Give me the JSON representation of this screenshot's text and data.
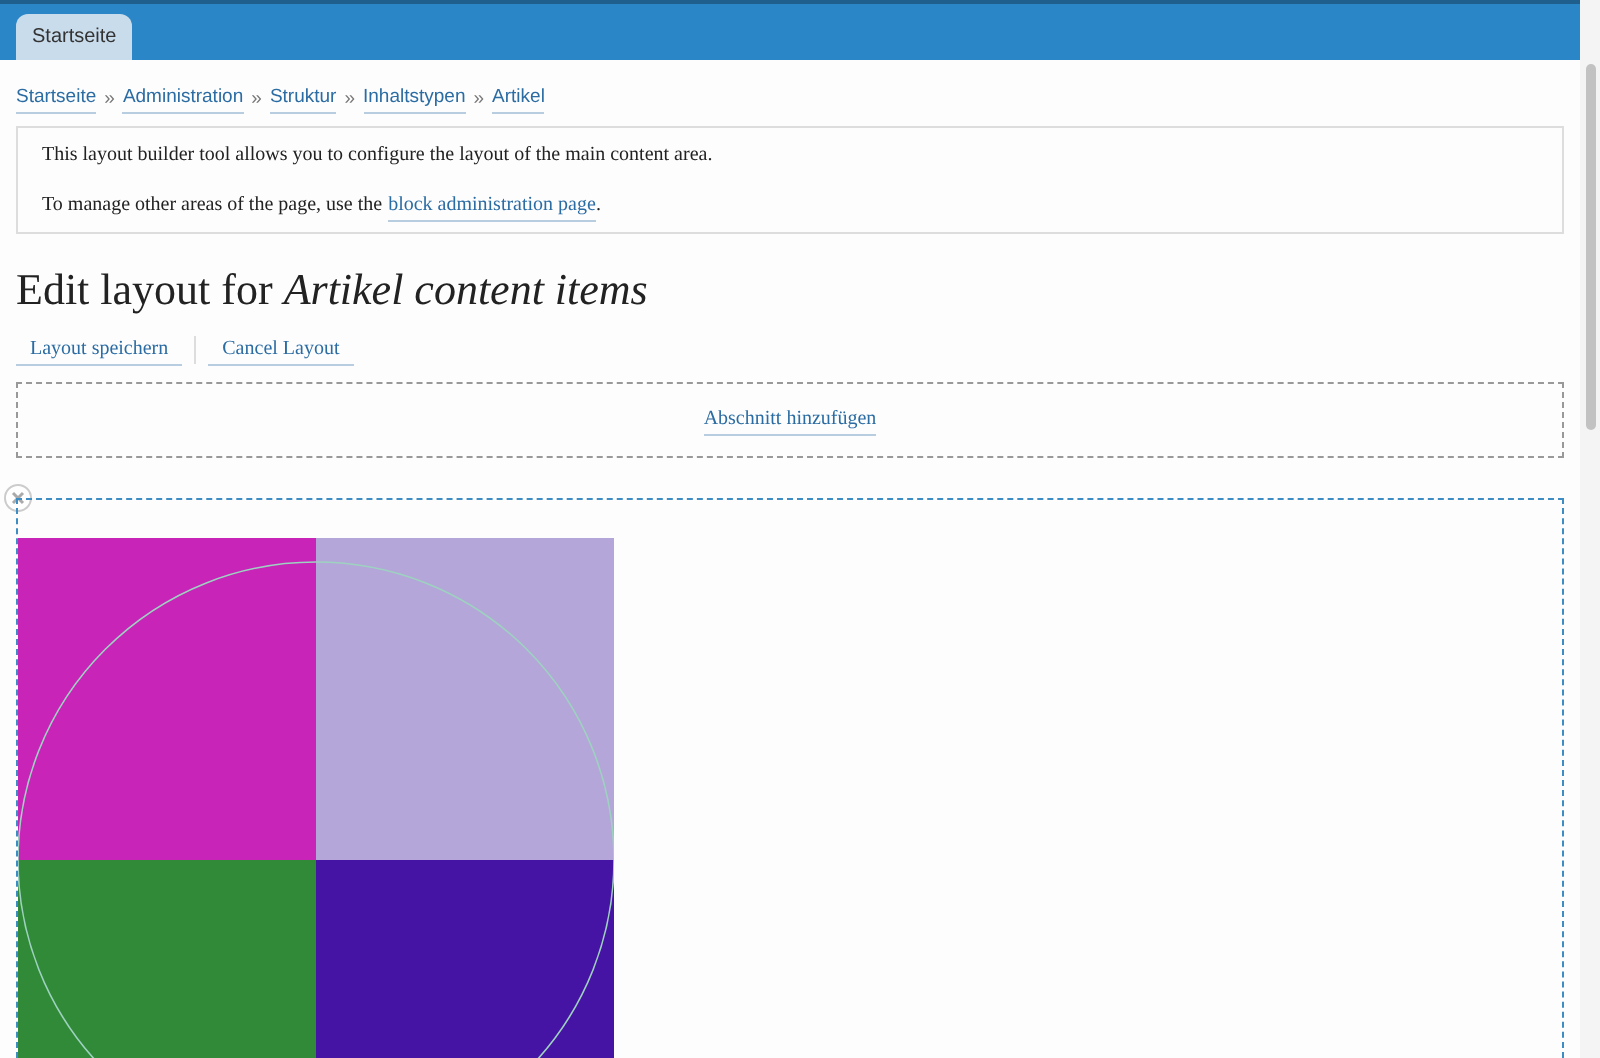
{
  "tabs": [
    {
      "label": "Startseite",
      "selected": true
    }
  ],
  "breadcrumb": [
    "Startseite",
    "Administration",
    "Struktur",
    "Inhaltstypen",
    "Artikel"
  ],
  "breadcrumb_separator": "»",
  "message": {
    "line_1": "This layout builder tool allows you to configure the layout of the main content area.",
    "line_2_before": "To manage other areas of the page, use the",
    "line_2_link": "block administration page",
    "line_2_after": "."
  },
  "title": "Edit layout for *Artikel content items*",
  "actions": [
    "Layout speichern",
    "Cancel Layout"
  ],
  "add_section": "Abschnitt hinzufügen",
  "section": {
    "image_quadrants": [
      {
        "color": "#c824b8"
      },
      {
        "color": "#b4a6d8"
      },
      {
        "color": "#318a37"
      },
      {
        "color": "#4614a5"
      }
    ]
  }
}
